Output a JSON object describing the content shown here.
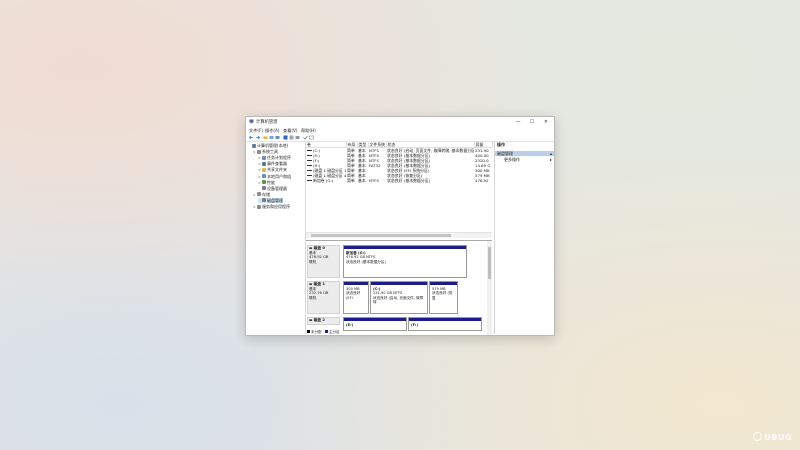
{
  "window": {
    "title": "计算机管理",
    "controls": {
      "minimize": "—",
      "maximize": "☐",
      "close": "✕"
    }
  },
  "menu": [
    "文件(F)",
    "操作(A)",
    "查看(V)",
    "帮助(H)"
  ],
  "tree": [
    {
      "label": "计算机管理(本地)",
      "icon": "computer-icon",
      "level": 0,
      "arrow": "",
      "color": "#6a7d9a"
    },
    {
      "label": "系统工具",
      "icon": "tools-icon",
      "level": 1,
      "arrow": "∨",
      "color": "#8b8b8b"
    },
    {
      "label": "任务计划程序",
      "icon": "clock-icon",
      "level": 2,
      "arrow": ">",
      "color": "#6e8fb3"
    },
    {
      "label": "事件查看器",
      "icon": "event-icon",
      "level": 2,
      "arrow": ">",
      "color": "#5a7b8f"
    },
    {
      "label": "共享文件夹",
      "icon": "folder-icon",
      "level": 2,
      "arrow": ">",
      "color": "#e2b64a"
    },
    {
      "label": "本地用户和组",
      "icon": "users-icon",
      "level": 2,
      "arrow": ">",
      "color": "#6c8bb5"
    },
    {
      "label": "性能",
      "icon": "performance-icon",
      "level": 2,
      "arrow": ">",
      "color": "#4f9a55"
    },
    {
      "label": "设备管理器",
      "icon": "device-icon",
      "level": 2,
      "arrow": "",
      "color": "#7c7c7c"
    },
    {
      "label": "存储",
      "icon": "storage-icon",
      "level": 1,
      "arrow": "∨",
      "color": "#8b8b8b"
    },
    {
      "label": "磁盘管理",
      "icon": "disk-icon",
      "level": 2,
      "arrow": "",
      "color": "#7c7c7c",
      "selected": true
    },
    {
      "label": "服务和应用程序",
      "icon": "services-icon",
      "level": 1,
      "arrow": ">",
      "color": "#8b8b8b"
    }
  ],
  "volume_table": {
    "headers": [
      "卷",
      "布局",
      "类型",
      "文件系统",
      "状态",
      "容量"
    ],
    "rows": [
      [
        "(C:)",
        "简单",
        "基本",
        "NTFS",
        "状态良好 (启动, 页面文件, 故障转储, 基本数据分区)",
        "231.90"
      ],
      [
        "(E:)",
        "简单",
        "基本",
        "NTFS",
        "状态良好 (基本数据分区)",
        "400.00"
      ],
      [
        "(F:)",
        "简单",
        "基本",
        "NTFS",
        "状态良好 (基本数据分区)",
        "2320.0"
      ],
      [
        "(H:)",
        "简单",
        "基本",
        "FAT32",
        "状态良好 (基本数据分区)",
        "14.69 G"
      ],
      [
        "(磁盘 1 磁盘分区 1)",
        "简单",
        "基本",
        "",
        "状态良好 (EFI 系统分区)",
        "300 MB"
      ],
      [
        "(磁盘 1 磁盘分区 4)",
        "简单",
        "基本",
        "",
        "状态良好 (恢复分区)",
        "579 MB"
      ],
      [
        "新加卷 (G:)",
        "简单",
        "基本",
        "NTFS",
        "状态良好 (基本数据分区)",
        "476.92"
      ]
    ]
  },
  "disks": [
    {
      "name": "磁盘 0",
      "type": "基本",
      "size": "476.92 GB",
      "status": "联机",
      "partitions": [
        {
          "title": "新加卷 (G:)",
          "line2": "476.92 GB NTFS",
          "line3": "状态良好 (基本数据分区)"
        }
      ]
    },
    {
      "name": "磁盘 1",
      "type": "基本",
      "size": "232.76 GB",
      "status": "联机",
      "partitions": [
        {
          "title": "",
          "line2": "300 MB",
          "line3": "状态良好 (EFI"
        },
        {
          "title": "(C:)",
          "line2": "231.90 GB NTFS",
          "line3": "状态良好 (启动, 页面文件, 故障转"
        },
        {
          "title": "",
          "line2": "579 MB",
          "line3": "状态良好 (恢复"
        }
      ]
    },
    {
      "name": "磁盘 2",
      "type": "",
      "size": "",
      "status": "",
      "partitions": [
        {
          "title": "(E:)",
          "line2": "",
          "line3": ""
        },
        {
          "title": "(F:)",
          "line2": "",
          "line3": ""
        }
      ]
    }
  ],
  "legend": [
    {
      "label": "未分配",
      "color": "#000000"
    },
    {
      "label": "主分区",
      "color": "#1c1c8a"
    }
  ],
  "actions": {
    "header": "操作",
    "section": "磁盘管理",
    "items": [
      "更多操作"
    ]
  },
  "watermark": "UBUG"
}
